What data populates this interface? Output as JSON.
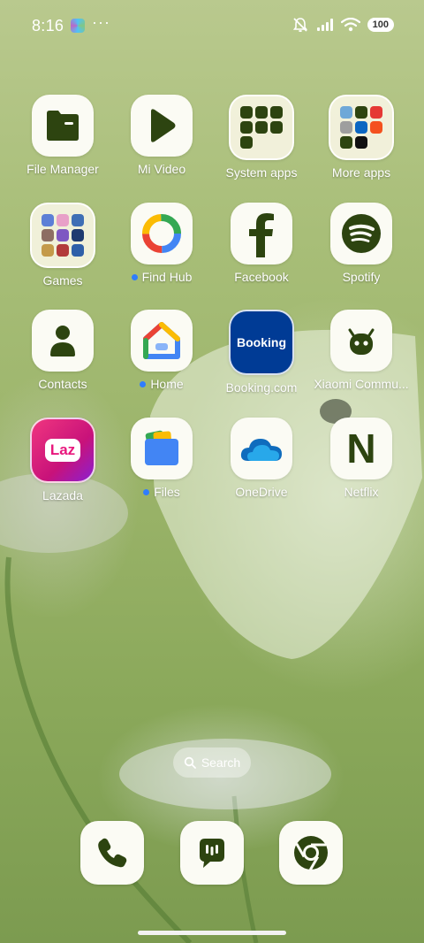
{
  "status_bar": {
    "time": "8:16",
    "more": "···",
    "battery": "100"
  },
  "apps": [
    {
      "label": "File Manager",
      "icon": "folder-icon"
    },
    {
      "label": "Mi Video",
      "icon": "play-icon"
    },
    {
      "label": "System apps",
      "icon": "folder-icon"
    },
    {
      "label": "More apps",
      "icon": "folder-icon"
    },
    {
      "label": "Games",
      "icon": "folder-icon"
    },
    {
      "label": "Find Hub",
      "icon": "find-hub-icon"
    },
    {
      "label": "Facebook",
      "icon": "facebook-icon"
    },
    {
      "label": "Spotify",
      "icon": "spotify-icon"
    },
    {
      "label": "Contacts",
      "icon": "contacts-icon"
    },
    {
      "label": "Home",
      "icon": "google-home-icon"
    },
    {
      "label": "Booking.com",
      "icon": "booking-icon",
      "icon_text": "Booking"
    },
    {
      "label": "Xiaomi Commu...",
      "icon": "xiaomi-community-icon"
    },
    {
      "label": "Lazada",
      "icon": "lazada-icon",
      "icon_text": "Laz"
    },
    {
      "label": "Files",
      "icon": "files-icon"
    },
    {
      "label": "OneDrive",
      "icon": "onedrive-icon"
    },
    {
      "label": "Netflix",
      "icon": "netflix-icon",
      "icon_text": "N"
    }
  ],
  "search": {
    "label": "Search"
  },
  "dock": [
    {
      "icon": "phone-icon"
    },
    {
      "icon": "messages-icon"
    },
    {
      "icon": "chrome-icon"
    }
  ],
  "colors": {
    "icon_bg": "#fbfbf4",
    "icon_glyph": "#2d4410",
    "notification_dot": "#2f7dff",
    "booking_blue": "#003b95",
    "lazada_pink": "#e8177d"
  }
}
